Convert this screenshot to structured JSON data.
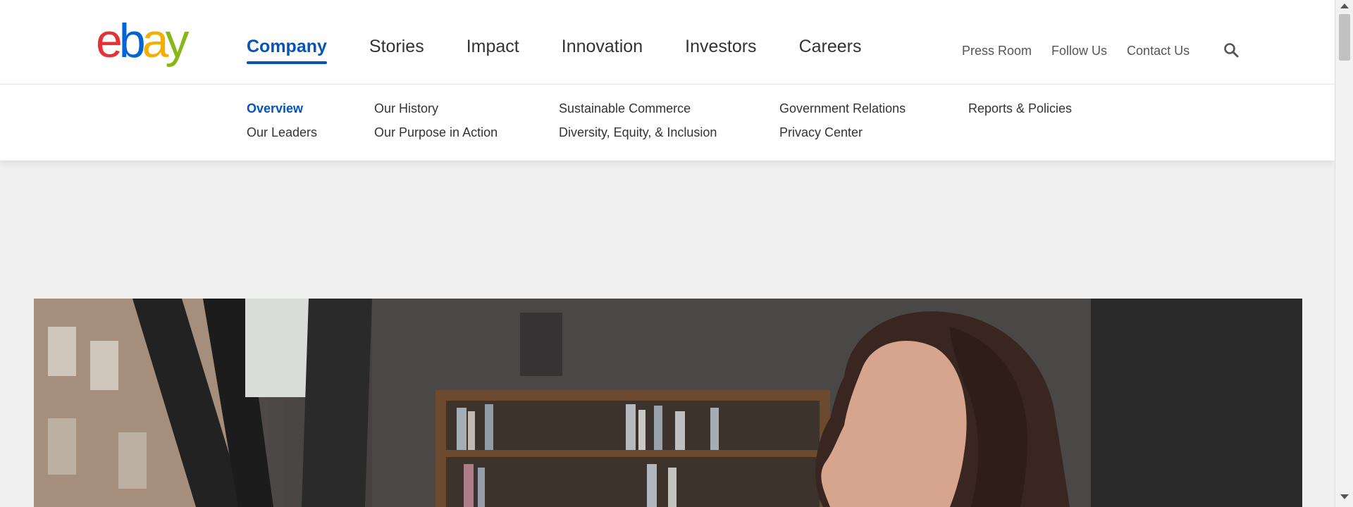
{
  "brand": {
    "logo_letters": [
      {
        "char": "e",
        "color": "#e53238"
      },
      {
        "char": "b",
        "color": "#0064d2"
      },
      {
        "char": "a",
        "color": "#f5af02"
      },
      {
        "char": "y",
        "color": "#86b817"
      }
    ]
  },
  "primary_nav": [
    {
      "label": "Company",
      "active": true
    },
    {
      "label": "Stories",
      "active": false
    },
    {
      "label": "Impact",
      "active": false
    },
    {
      "label": "Innovation",
      "active": false
    },
    {
      "label": "Investors",
      "active": false
    },
    {
      "label": "Careers",
      "active": false
    }
  ],
  "utility_nav": [
    "Press Room",
    "Follow Us",
    "Contact Us"
  ],
  "search": {
    "icon": "search-icon"
  },
  "subnav": {
    "col1": [
      "Overview",
      "Our Leaders"
    ],
    "col2": [
      "Our History",
      "Our Purpose in Action"
    ],
    "col3": [
      "Sustainable Commerce",
      "Diversity, Equity, & Inclusion"
    ],
    "col4": [
      "Government Relations",
      "Privacy Center"
    ],
    "col5": [
      "Reports & Policies"
    ],
    "active": "Overview"
  },
  "colors": {
    "accent": "#0654ba",
    "page_bg": "#f0f0f0"
  }
}
